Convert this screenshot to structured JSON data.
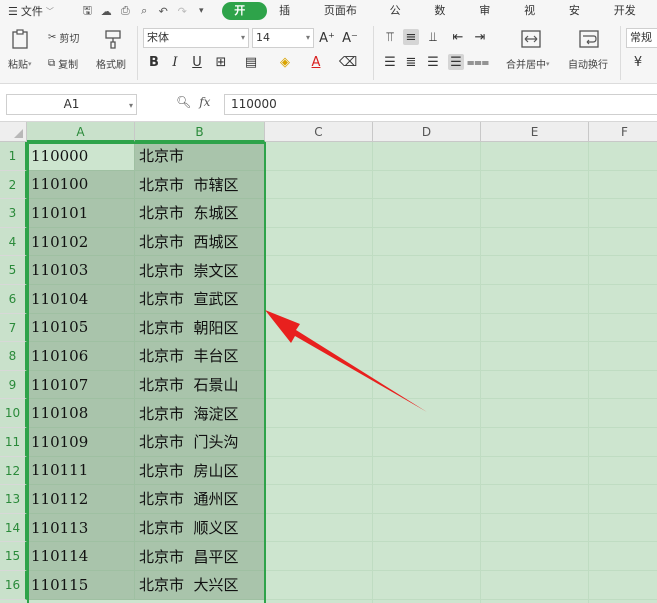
{
  "menubar": {
    "file_label": "文件",
    "tabs": [
      {
        "label": "开始",
        "active": true
      },
      {
        "label": "插入",
        "active": false
      },
      {
        "label": "页面布局",
        "active": false
      },
      {
        "label": "公式",
        "active": false
      },
      {
        "label": "数据",
        "active": false
      },
      {
        "label": "审阅",
        "active": false
      },
      {
        "label": "视图",
        "active": false
      },
      {
        "label": "安全",
        "active": false
      },
      {
        "label": "开发工",
        "active": false
      }
    ]
  },
  "ribbon": {
    "paste_label": "粘贴",
    "cut_label": "剪切",
    "copy_label": "复制",
    "format_painter_label": "格式刷",
    "font_name": "宋体",
    "font_size": "14",
    "merge_center_label": "合并居中",
    "auto_wrap_label": "自动换行",
    "number_format": "常规"
  },
  "formula_bar": {
    "cell_ref": "A1",
    "fx_label": "fx",
    "formula": "110000"
  },
  "sheet": {
    "columns": [
      "A",
      "B",
      "C",
      "D",
      "E",
      "F"
    ],
    "rows": [
      {
        "num": "1",
        "a": "110000",
        "b": "北京市"
      },
      {
        "num": "2",
        "a": "110100",
        "b": "北京市  市辖区"
      },
      {
        "num": "3",
        "a": "110101",
        "b": "北京市  东城区"
      },
      {
        "num": "4",
        "a": "110102",
        "b": "北京市  西城区"
      },
      {
        "num": "5",
        "a": "110103",
        "b": "北京市  崇文区"
      },
      {
        "num": "6",
        "a": "110104",
        "b": "北京市  宣武区"
      },
      {
        "num": "7",
        "a": "110105",
        "b": "北京市  朝阳区"
      },
      {
        "num": "8",
        "a": "110106",
        "b": "北京市  丰台区"
      },
      {
        "num": "9",
        "a": "110107",
        "b": "北京市  石景山"
      },
      {
        "num": "10",
        "a": "110108",
        "b": "北京市  海淀区"
      },
      {
        "num": "11",
        "a": "110109",
        "b": "北京市  门头沟"
      },
      {
        "num": "12",
        "a": "110111",
        "b": "北京市  房山区"
      },
      {
        "num": "13",
        "a": "110112",
        "b": "北京市  通州区"
      },
      {
        "num": "14",
        "a": "110113",
        "b": "北京市  顺义区"
      },
      {
        "num": "15",
        "a": "110114",
        "b": "北京市  昌平区"
      },
      {
        "num": "16",
        "a": "110115",
        "b": "北京市  大兴区"
      }
    ]
  },
  "colors": {
    "accent": "#2ea34a",
    "selected_fill": "#a9c4ab",
    "background_tint": "#cde5cf",
    "arrow": "#e8201e"
  }
}
